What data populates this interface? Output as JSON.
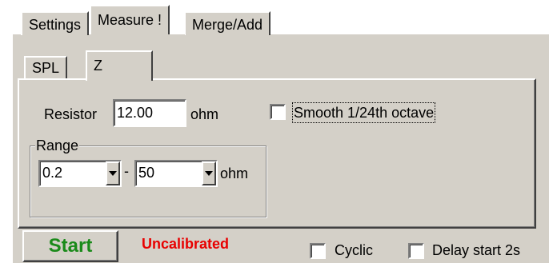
{
  "tabs": {
    "items": [
      {
        "label": "Settings"
      },
      {
        "label": "Measure !"
      },
      {
        "label": "Merge/Add"
      }
    ],
    "active": "Measure !"
  },
  "subtabs": {
    "items": [
      {
        "label": "SPL"
      },
      {
        "label": "Z"
      }
    ],
    "active": "Z"
  },
  "resistor": {
    "label": "Resistor",
    "value": "12.00",
    "unit": "ohm"
  },
  "smooth": {
    "label": "Smooth 1/24th octave",
    "checked": false
  },
  "range": {
    "title": "Range",
    "min_value": "0.2",
    "separator": "-",
    "max_value": "50",
    "unit": "ohm"
  },
  "bottom": {
    "start_label": "Start",
    "status": "Uncalibrated",
    "status_color": "#e80000",
    "start_color": "#1a8a1a",
    "cyclic_label": "Cyclic",
    "cyclic_checked": false,
    "delay_label": "Delay start 2s",
    "delay_checked": false
  },
  "icons": {
    "dropdown": "chevron-down-icon"
  }
}
